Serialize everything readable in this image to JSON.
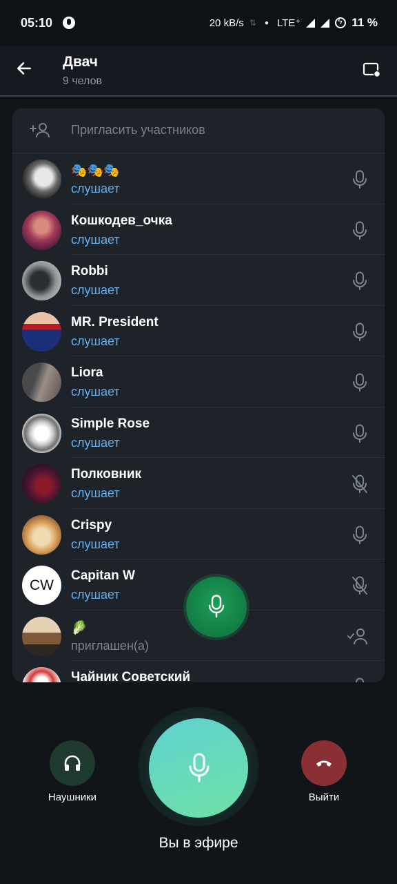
{
  "status_bar": {
    "time": "05:10",
    "speed": "20 kB/s",
    "network": "LTE⁺",
    "battery": "11 %"
  },
  "header": {
    "title": "Двач",
    "subtitle": "9 челов"
  },
  "invite": {
    "label": "Пригласить участников"
  },
  "participants": [
    {
      "name": "🎭🎭🎭",
      "status": "слушает",
      "status_type": "listening",
      "mic": "available"
    },
    {
      "name": "Кошкодев_очка",
      "status": "слушает",
      "status_type": "listening",
      "mic": "available"
    },
    {
      "name": "Robbi",
      "status": "слушает",
      "status_type": "listening",
      "mic": "available"
    },
    {
      "name": "MR. President",
      "status": "слушает",
      "status_type": "listening",
      "mic": "available"
    },
    {
      "name": "Liora",
      "status": "слушает",
      "status_type": "listening",
      "mic": "available"
    },
    {
      "name": "Simple Rose",
      "status": "слушает",
      "status_type": "listening",
      "mic": "available"
    },
    {
      "name": "Полковник",
      "status": "слушает",
      "status_type": "listening",
      "mic": "muted"
    },
    {
      "name": "Crispy",
      "status": "слушает",
      "status_type": "listening",
      "mic": "available"
    },
    {
      "name": "Capitan W",
      "initials": "CW",
      "status": "слушает",
      "status_type": "listening",
      "mic": "muted"
    },
    {
      "name": "🥬",
      "status": "приглашен(а)",
      "status_type": "invited",
      "mic": "invited"
    },
    {
      "name": "Чайник Советский",
      "status": "",
      "status_type": "listening",
      "mic": "available"
    }
  ],
  "controls": {
    "headphones_label": "Наушники",
    "leave_label": "Выйти",
    "on_air_label": "Вы в эфире"
  },
  "colors": {
    "accent_blue": "#62b2f1",
    "mic_green": "#1e9e58",
    "leave_red": "#8a2f33",
    "headphones_bg": "#1f3a2e"
  }
}
